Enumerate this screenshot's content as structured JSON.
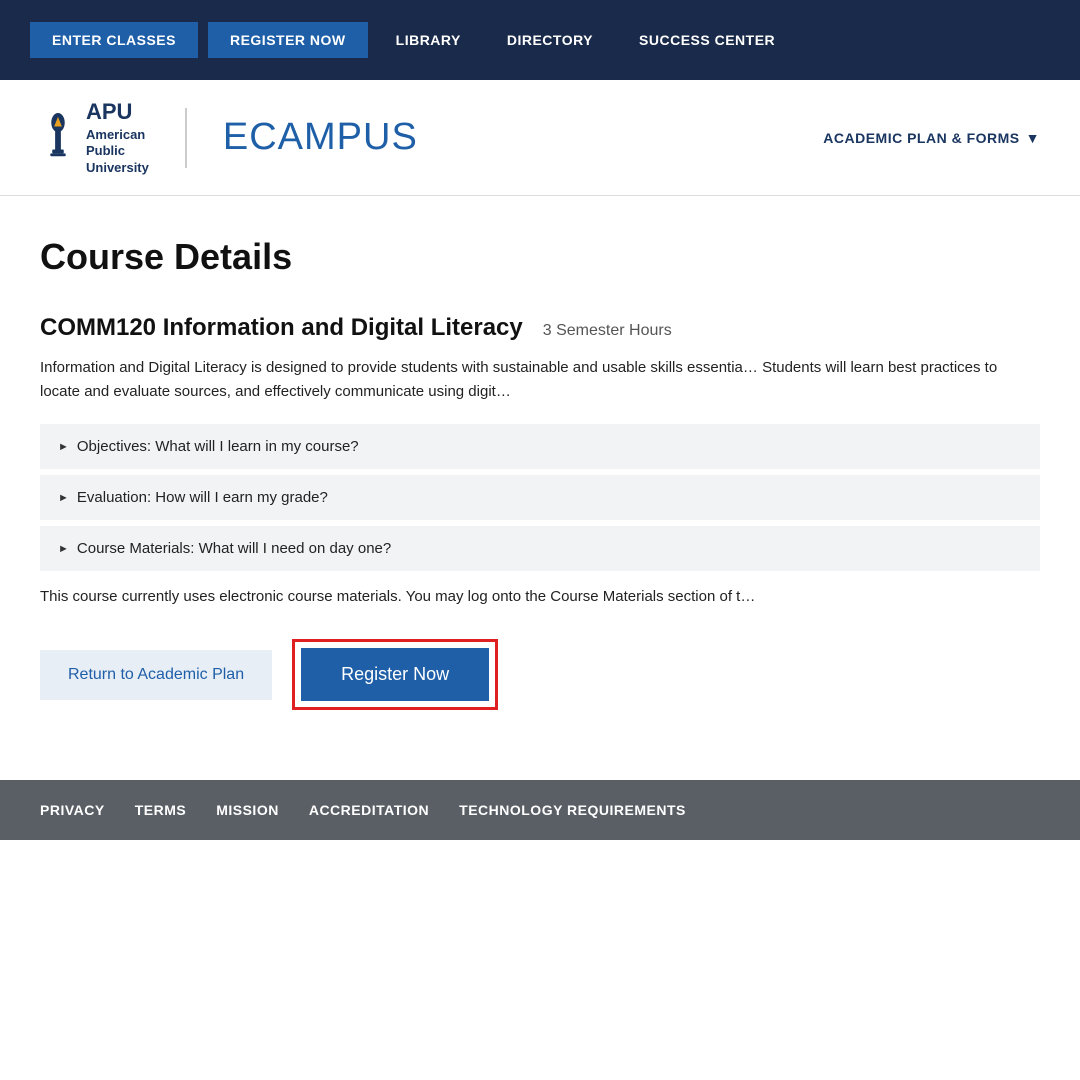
{
  "topnav": {
    "btn_enter_classes": "ENTER CLASSES",
    "btn_register_now": "REGISTER NOW",
    "link_library": "LIBRARY",
    "link_directory": "DIRECTORY",
    "link_success_center": "SUCCESS CENTER"
  },
  "header": {
    "university_line1": "American",
    "university_line2": "Public",
    "university_line3": "University",
    "apu_badge": "APU",
    "ecampus": "ECAMPUS",
    "academic_plan_btn": "ACADEMIC PLAN & FORMS"
  },
  "main": {
    "page_title": "Course Details",
    "course_name": "COMM120 Information and Digital Literacy",
    "semester_hours": "3 Semester Hours",
    "course_description": "Information and Digital Literacy is designed to provide students with sustainable and usable skills essentia… Students will learn best practices to locate and evaluate sources, and effectively communicate using digit…",
    "accordion": [
      {
        "label": "Objectives: What will I learn in my course?"
      },
      {
        "label": "Evaluation: How will I earn my grade?"
      },
      {
        "label": "Course Materials: What will I need on day one?"
      }
    ],
    "materials_note": "This course currently uses electronic course materials. You may log onto the Course Materials section of t…",
    "btn_return": "Return to Academic Plan",
    "btn_register": "Register Now"
  },
  "footer": {
    "links": [
      "PRIVACY",
      "TERMS",
      "MISSION",
      "ACCREDITATION",
      "TECHNOLOGY REQUIREMENTS"
    ]
  }
}
